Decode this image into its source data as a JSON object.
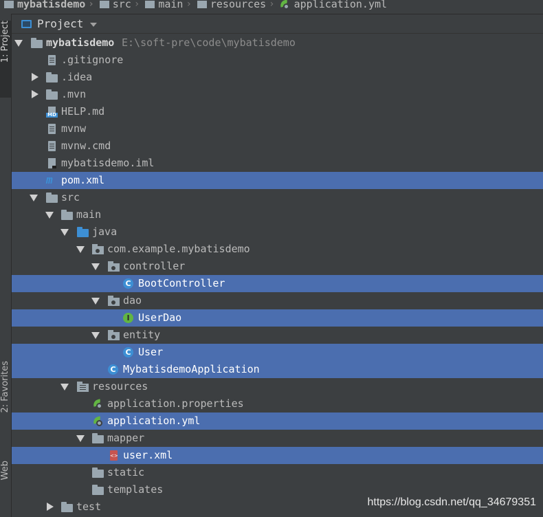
{
  "breadcrumb": {
    "items": [
      "mybatisdemo",
      "src",
      "main",
      "resources",
      "application.yml"
    ],
    "separator": "›"
  },
  "tool_strip": {
    "project_tab": "1: Project",
    "favorites_tab": "2: Favorites",
    "web_tab": "Web"
  },
  "panel": {
    "title": "Project"
  },
  "tree": {
    "root": {
      "label": "mybatisdemo",
      "path": "E:\\soft-pre\\code\\mybatisdemo"
    },
    "gitignore": ".gitignore",
    "idea": ".idea",
    "mvn": ".mvn",
    "help": "HELP.md",
    "mvnw": "mvnw",
    "mvnw_cmd": "mvnw.cmd",
    "iml": "mybatisdemo.iml",
    "pom": "pom.xml",
    "src": "src",
    "main": "main",
    "java": "java",
    "package": "com.example.mybatisdemo",
    "controller": "controller",
    "boot_controller": "BootController",
    "dao": "dao",
    "user_dao": "UserDao",
    "entity": "entity",
    "user": "User",
    "app_class": "MybatisdemoApplication",
    "resources": "resources",
    "app_properties": "application.properties",
    "app_yml": "application.yml",
    "mapper": "mapper",
    "user_xml": "user.xml",
    "static": "static",
    "templates": "templates",
    "test": "test"
  },
  "icons": {
    "class_letter": "C",
    "interface_letter": "I",
    "md_badge": "MD",
    "maven_letter": "m"
  },
  "colors": {
    "background": "#3c3f41",
    "selection": "#4b6eaf",
    "folder_blue": "#3d8fd4",
    "spring_green": "#62b543"
  },
  "watermark": "https://blog.csdn.net/qq_34679351"
}
